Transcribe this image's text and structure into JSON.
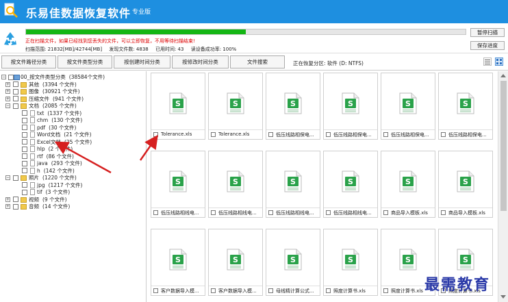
{
  "app": {
    "title": "乐易佳数据恢复软件",
    "edition": "专业版",
    "brand_color": "#1e8fe0"
  },
  "status": {
    "progress": 0.5,
    "progress_color": "#14b614",
    "message": "正在扫描文件，如果已经找到您丢失的文件，可以立即恢复，不用等待扫描结束!",
    "scan_range": "扫描范围: 21832[MB]/42744[MB]",
    "found_files": "发现文件数: 4838",
    "elapsed": "已用时间: 43",
    "read_rate": "读设备成功率: 100%",
    "pause_label": "暂停扫描",
    "save_label": "保存进度"
  },
  "tabs": [
    {
      "label": "按文件路径分类"
    },
    {
      "label": "按文件类型分类"
    },
    {
      "label": "按创建时间分类"
    },
    {
      "label": "按修改时间分类"
    },
    {
      "label": "文件搜索"
    }
  ],
  "current_path": "正在恢复分区: 软件 (D: NTFS)",
  "tree": [
    {
      "label": "00_按文件类型分类",
      "count": "(38584个文件)"
    },
    {
      "label": "其他",
      "count": "(3394 个文件)"
    },
    {
      "label": "图像",
      "count": "(30921 个文件)"
    },
    {
      "label": "压缩文件",
      "count": "(941 个文件)"
    },
    {
      "label": "文档",
      "count": "(2085 个文件)"
    },
    {
      "label": "txt",
      "count": "(1337 个文件)"
    },
    {
      "label": "chm",
      "count": "(130 个文件)"
    },
    {
      "label": "pdf",
      "count": "(30 个文件)"
    },
    {
      "label": "Word文档",
      "count": "(21 个文件)"
    },
    {
      "label": "Excel文档",
      "count": "(25 个文件)"
    },
    {
      "label": "hlp",
      "count": "(2 个文件)"
    },
    {
      "label": "rtf",
      "count": "(86 个文件)"
    },
    {
      "label": "java",
      "count": "(293 个文件)"
    },
    {
      "label": "h",
      "count": "(142 个文件)"
    },
    {
      "label": "照片",
      "count": "(1220 个文件)"
    },
    {
      "label": "jpg",
      "count": "(1217 个文件)"
    },
    {
      "label": "tif",
      "count": "(3 个文件)"
    },
    {
      "label": "视频",
      "count": "(9 个文件)"
    },
    {
      "label": "音频",
      "count": "(14 个文件)"
    }
  ],
  "files": [
    {
      "name": "Tolerance.xls"
    },
    {
      "name": "Tolerance.xls"
    },
    {
      "name": "低压线路相保电..."
    },
    {
      "name": "低压线路相保电..."
    },
    {
      "name": "低压线路相保电..."
    },
    {
      "name": "低压线路相保电..."
    },
    {
      "name": "低压线路相线电..."
    },
    {
      "name": "低压线路相线电..."
    },
    {
      "name": "低压线路相线电..."
    },
    {
      "name": "低压线路相线电..."
    },
    {
      "name": "商品导入模板.xls"
    },
    {
      "name": "商品导入模板.xls"
    },
    {
      "name": "客户数据导入模..."
    },
    {
      "name": "客户数据导入模..."
    },
    {
      "name": "母线精计算公式..."
    },
    {
      "name": "照度计算书.xls"
    },
    {
      "name": "照度计算书.xls"
    },
    {
      "name": "照度计算书.xls"
    }
  ],
  "watermark": "最需教育",
  "colors": {
    "annotation_arrow": "#d62020",
    "excel_green": "#2aa24a"
  }
}
